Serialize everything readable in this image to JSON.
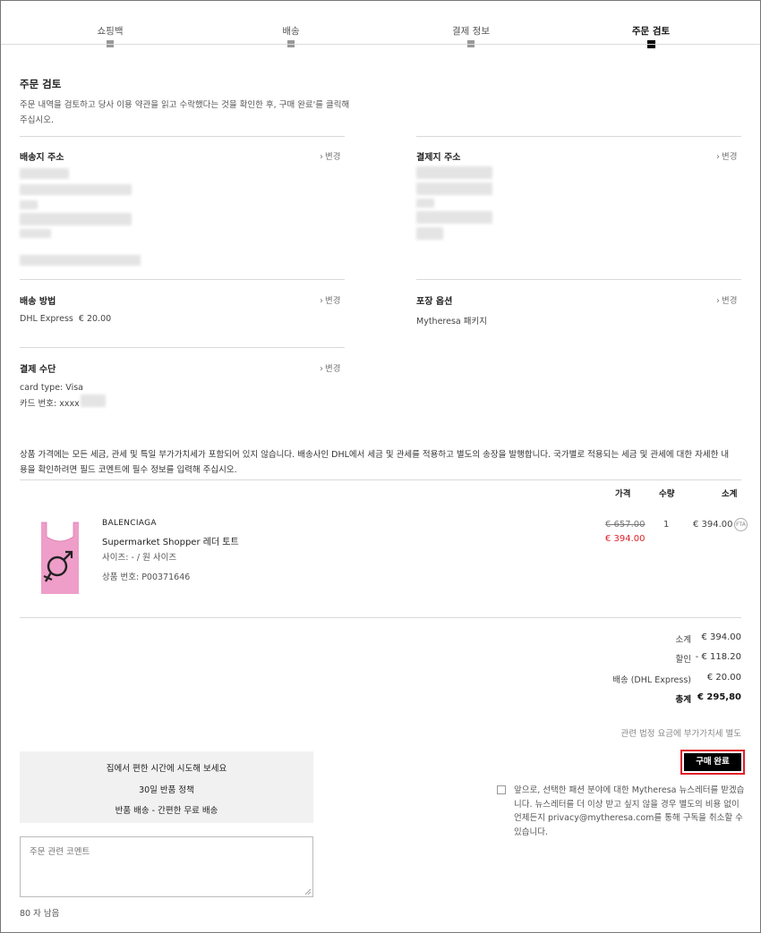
{
  "steps": [
    {
      "label": "쇼핑백",
      "active": false
    },
    {
      "label": "배송",
      "active": false
    },
    {
      "label": "결제 정보",
      "active": false
    },
    {
      "label": "주문 검토",
      "active": true
    }
  ],
  "review": {
    "title": "주문 검토",
    "intro": "주문 내역을 검토하고 당사 이용 약관을 읽고 수락했다는 것을 확인한 후, 구매 완료'를 클릭해 주십시오."
  },
  "change_label": "변경",
  "shipping_address": {
    "title": "배송지 주소"
  },
  "billing_address": {
    "title": "결제지 주소"
  },
  "shipping_method": {
    "title": "배송 방법",
    "value": "DHL Express  € 20.00"
  },
  "packaging": {
    "title": "포장 옵션",
    "value": "Mytheresa 패키지"
  },
  "payment": {
    "title": "결제 수단",
    "card_type": "card type: Visa",
    "card_number": "카드 번호: xxxx"
  },
  "notice": "상품 가격에는 모든 세금, 관세 및 특일 부가가치세가 포함되어 있지 않습니다. 배송사인 DHL에서 세금 및 관세를 적용하고 별도의 송장을 발행합니다. 국가별로 적용되는 세금 및 관세에 대한 자세한 내용을 확인하려면 필드 코멘트에 필수 정보를 입력해 주십시오.",
  "table": {
    "col_price": "가격",
    "col_qty": "수량",
    "col_subtotal": "소계"
  },
  "item": {
    "brand": "BALENCIAGA",
    "name": "Supermarket Shopper 레더 토트",
    "size": "사이즈: - / 원 사이즈",
    "product_no": "상품 번호: P00371646",
    "price_old": "€ 657.00",
    "price_new": "€ 394.00",
    "qty": "1",
    "subtotal": "€ 394.00",
    "badge": "FTA"
  },
  "summary": {
    "subtotal_label": "소계",
    "subtotal_value": "€ 394.00",
    "discount_label": "할인",
    "discount_value": "- € 118.20",
    "shipping_label": "배송 (DHL Express)",
    "shipping_value": "€ 20.00",
    "total_label": "총계",
    "total_value": "€ 295,80",
    "vat_note": "관련 법정 요금에 부가가치세 별도"
  },
  "buy_button": "구매 완료",
  "promo": {
    "line1": "집에서 편한 시간에 시도해 보세요",
    "line2": "30일 반품 정책",
    "line3": "반품 배송 - 간편한 무료 배송"
  },
  "comment": {
    "placeholder": "주문 관련 코멘트",
    "remaining": "80 자 남음"
  },
  "newsletter_text": "앞으로, 선택한 패션 분야에 대한 Mytheresa 뉴스레터를 받겠습니다. 뉴스레터를 더 이상 받고 싶지 않을 경우 별도의 비용 없이 언제든지 privacy@mytheresa.com를 통해 구독을 취소할 수 있습니다.",
  "colors": {
    "accent_red": "#e0202a",
    "button_black": "#000000",
    "promo_bg": "#f1f1f1"
  }
}
